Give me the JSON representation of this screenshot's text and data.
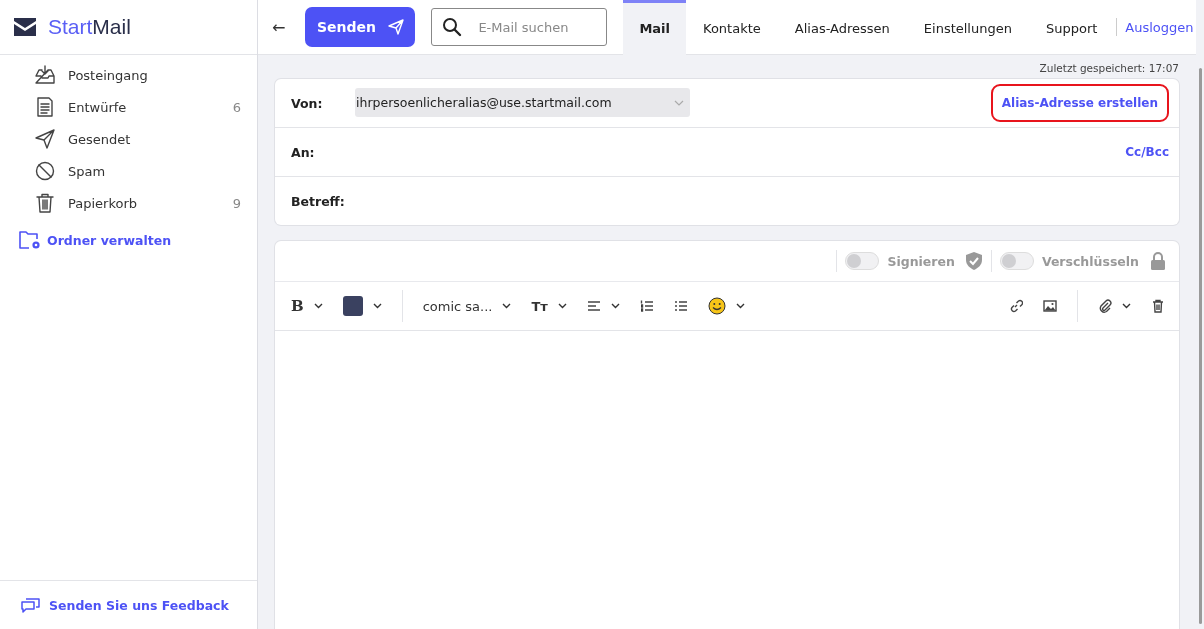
{
  "logo": {
    "part1": "Start",
    "part2": "Mail"
  },
  "sidebar": {
    "folders": [
      {
        "kind": "inbox",
        "label": "Posteingang",
        "selected": false
      },
      {
        "kind": "draft",
        "label": "Entwürfe",
        "count": "6",
        "selected": false
      },
      {
        "kind": "sent",
        "label": "Gesendet",
        "selected": false
      },
      {
        "kind": "spam",
        "label": "Spam",
        "selected": false
      },
      {
        "kind": "trash",
        "label": "Papierkorb",
        "count": "9",
        "selected": false
      }
    ],
    "manage_link": "Ordner verwalten",
    "feedback_link": "Senden Sie uns Feedback"
  },
  "topbar": {
    "back": "←",
    "send_button": "Senden",
    "search": {
      "placeholder": "E-Mail suchen"
    },
    "tabs": [
      {
        "label": "Mail",
        "selected": true
      },
      {
        "label": "Kontakte",
        "selected": false
      },
      {
        "label": "Alias-Adressen",
        "selected": false
      },
      {
        "label": "Einstellungen",
        "selected": false
      },
      {
        "label": "Support",
        "selected": false
      }
    ],
    "logout": "Ausloggen"
  },
  "saved_status": "Zuletzt gespeichert: 17:07",
  "compose": {
    "from_label": "Von:",
    "from_value": "ihrpersoenlicheralias@use.startmail.com",
    "create_alias": {
      "label": "Alias-Adresse erstellen",
      "highlighted": true
    },
    "to_label": "An:",
    "cc_bcc": "Cc/Bcc",
    "subject_label": "Betreff:"
  },
  "editor": {
    "toggles": [
      {
        "label": "Signieren",
        "kind": "sign",
        "on": false
      },
      {
        "label": "Verschlüsseln",
        "kind": "encrypt",
        "on": false
      }
    ],
    "toolbar": {
      "bold": "B",
      "font": "comic sa...",
      "size": "Tт"
    }
  }
}
